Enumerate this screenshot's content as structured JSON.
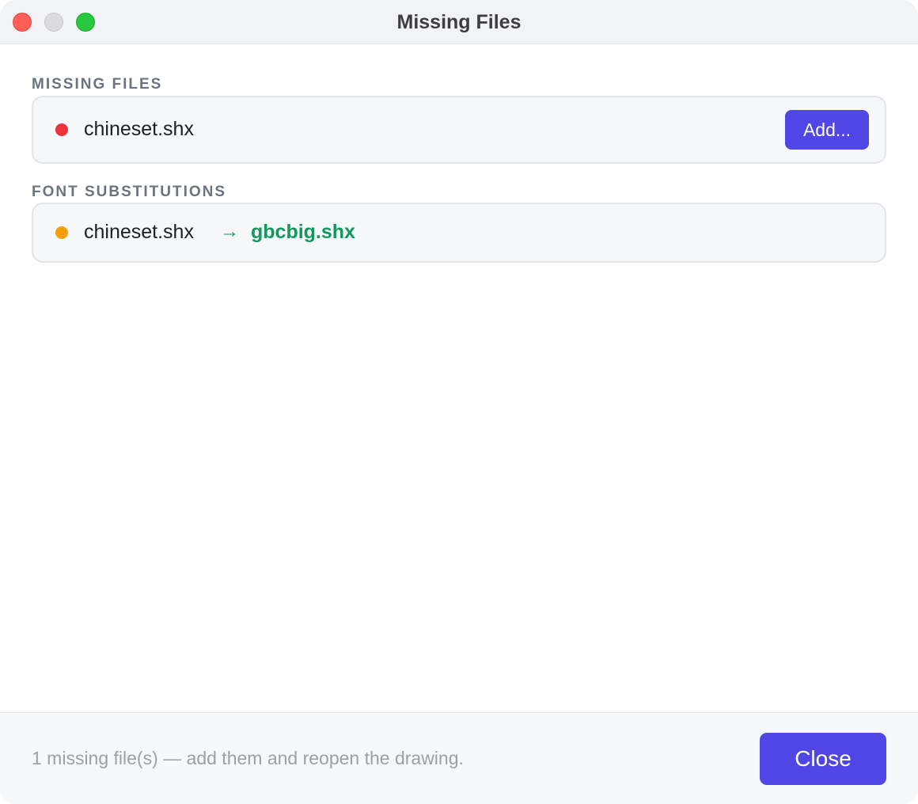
{
  "window": {
    "title": "Missing Files",
    "traffic_lights": {
      "close_color": "#ff5f57",
      "minimize_color": "#dcdcdf",
      "maximize_color": "#28c840"
    }
  },
  "missing_files": {
    "heading": "MISSING FILES",
    "items": [
      {
        "name": "chineset.shx",
        "status_color": "#f0323c",
        "action_label": "Add..."
      }
    ]
  },
  "font_substitutions": {
    "heading": "FONT SUBSTITUTIONS",
    "items": [
      {
        "original": "chineset.shx",
        "arrow": "→",
        "substitute": "gbcbig.shx",
        "status_color": "#f59e0b",
        "substitute_color": "#0f9a5c"
      }
    ]
  },
  "footer": {
    "status_text": "1 missing file(s) — add them and reopen the drawing.",
    "close_label": "Close"
  },
  "colors": {
    "accent": "#4f46e5"
  }
}
